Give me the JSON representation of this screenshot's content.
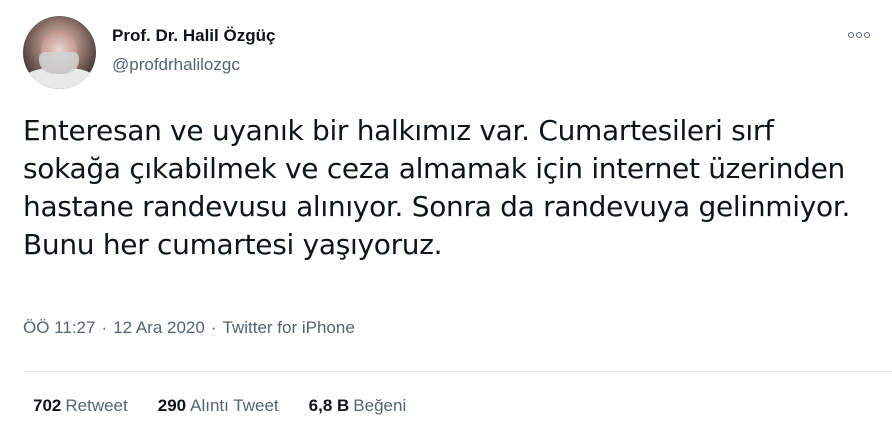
{
  "user": {
    "name": "Prof. Dr. Halil Özgüç",
    "handle": "@profdrhalilozgc"
  },
  "tweet": {
    "text": "Enteresan ve uyanık bir halkımız var. Cumartesileri sırf sokağa çıkabilmek ve ceza almamak için internet üzerinden hastane randevusu alınıyor. Sonra da randevuya gelinmiyor. Bunu her cumartesi yaşıyoruz.",
    "time": "ÖÖ 11:27",
    "separator": "·",
    "date": "12 Ara 2020",
    "source": "Twitter for iPhone"
  },
  "stats": {
    "retweets": {
      "count": "702",
      "label": "Retweet"
    },
    "quotes": {
      "count": "290",
      "label": "Alıntı Tweet"
    },
    "likes": {
      "count": "6,8 B",
      "label": "Beğeni"
    }
  },
  "icons": {
    "more": "more-options-icon"
  },
  "colors": {
    "text": "#0f1419",
    "secondary": "#536471",
    "divider": "#e6ecf0"
  }
}
